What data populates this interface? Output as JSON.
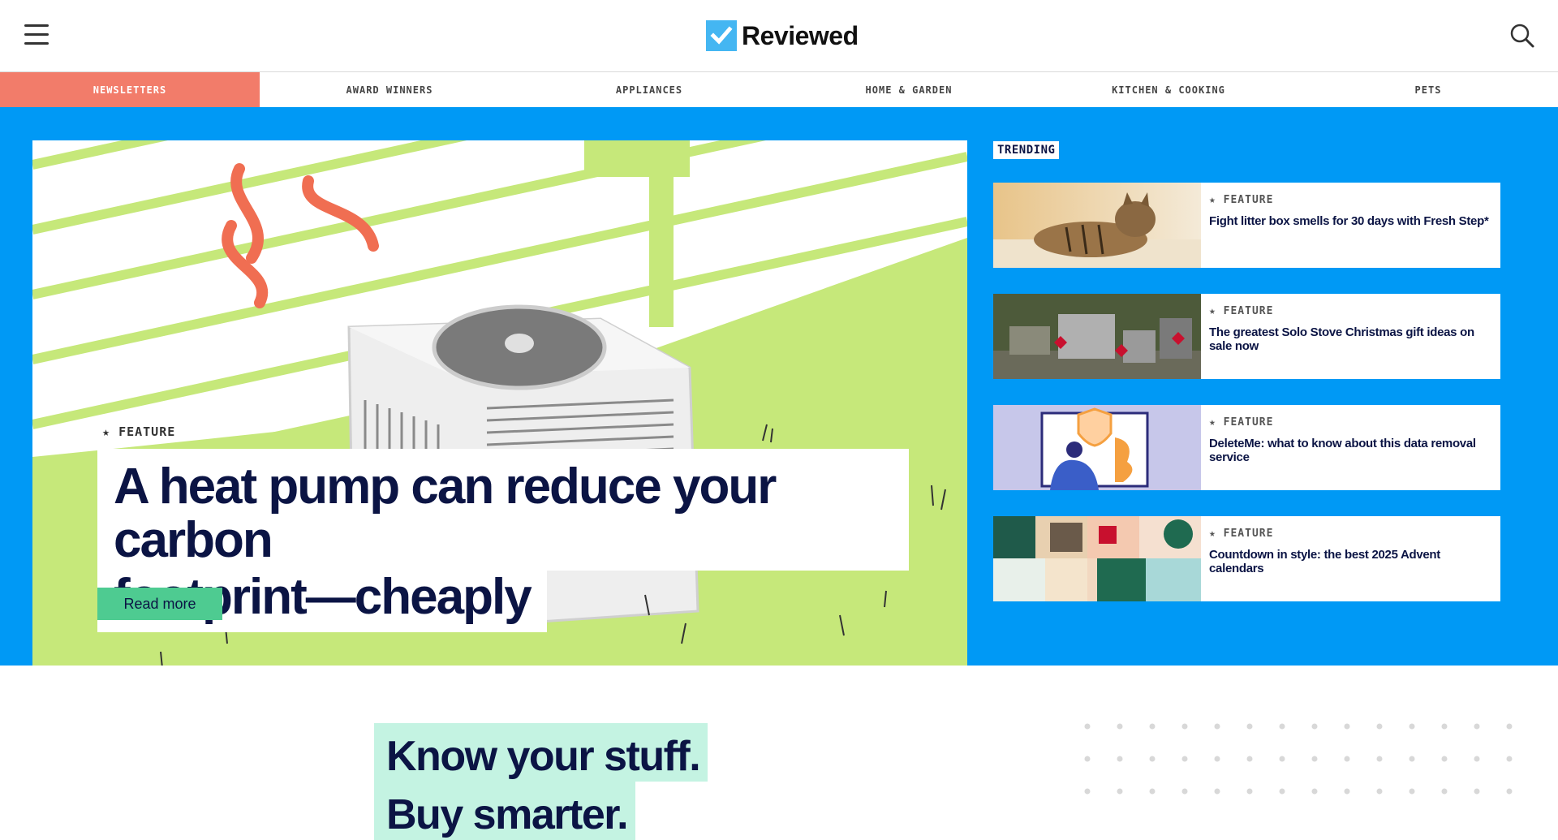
{
  "header": {
    "brand": "Reviewed",
    "menu_icon": "hamburger-menu-icon",
    "search_icon": "search-icon"
  },
  "nav": {
    "items": [
      {
        "label": "NEWSLETTERS",
        "active": true
      },
      {
        "label": "AWARD WINNERS",
        "active": false
      },
      {
        "label": "APPLIANCES",
        "active": false
      },
      {
        "label": "HOME & GARDEN",
        "active": false
      },
      {
        "label": "KITCHEN & COOKING",
        "active": false
      },
      {
        "label": "PETS",
        "active": false
      }
    ]
  },
  "hero": {
    "kicker": "FEATURE",
    "title_line1": "A heat pump can reduce your carbon",
    "title_line2": "footprint—cheaply",
    "cta": "Read more"
  },
  "trending": {
    "label": "TRENDING",
    "items": [
      {
        "kicker": "FEATURE",
        "title": "Fight litter box smells for 30 days with Fresh Step*"
      },
      {
        "kicker": "FEATURE",
        "title": "The greatest Solo Stove Christmas gift ideas on sale now"
      },
      {
        "kicker": "FEATURE",
        "title": "DeleteMe: what to know about this data removal service"
      },
      {
        "kicker": "FEATURE",
        "title": "Countdown in style: the best 2025 Advent calendars"
      }
    ]
  },
  "tagline": {
    "line1": "Know your stuff.",
    "line2": "Buy smarter."
  },
  "colors": {
    "brand_blue": "#0099f5",
    "nav_active": "#f27c6a",
    "cta_green": "#4ecb91",
    "tagline_bg": "#c4f3e2",
    "ink": "#0b1444"
  }
}
